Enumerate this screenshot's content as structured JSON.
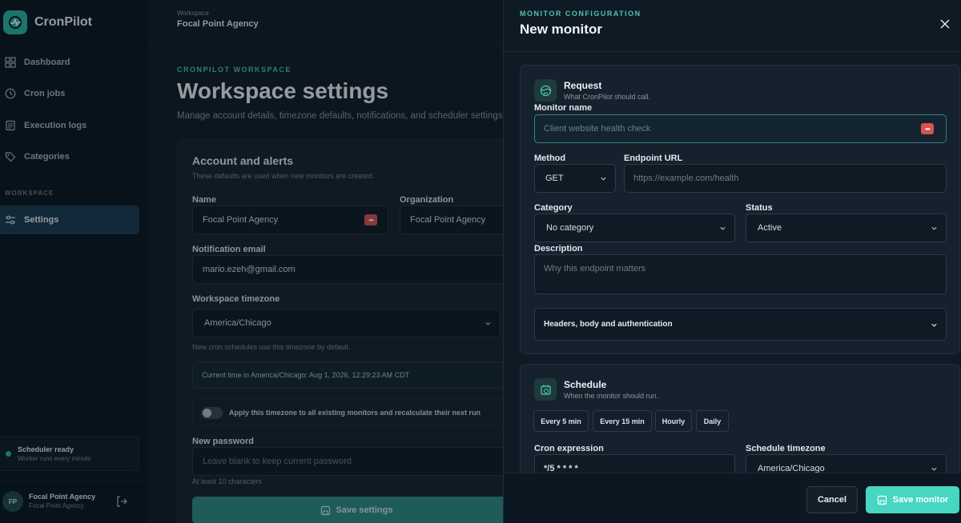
{
  "brand": {
    "name": "CronPilot"
  },
  "sidebar": {
    "items": [
      {
        "label": "Dashboard",
        "icon": "grid-icon"
      },
      {
        "label": "Cron jobs",
        "icon": "clock-icon"
      },
      {
        "label": "Execution logs",
        "icon": "log-icon"
      },
      {
        "label": "Categories",
        "icon": "tag-icon"
      }
    ],
    "section_label": "WORKSPACE",
    "settings_label": "Settings",
    "scheduler": {
      "title": "Scheduler ready",
      "subtitle": "Worker runs every minute"
    },
    "user": {
      "initials": "FP",
      "name": "Focal Point Agency",
      "org": "Focal Point Agency"
    }
  },
  "topbar": {
    "label": "Workspace",
    "title": "Focal Point Agency"
  },
  "page": {
    "eyebrow": "CRONPILOT WORKSPACE",
    "title": "Workspace settings",
    "description": "Manage account details, timezone defaults, notifications, and scheduler settings."
  },
  "account": {
    "title": "Account and alerts",
    "subtitle": "These defaults are used when new monitors are created.",
    "name_label": "Name",
    "name_value": "Focal Point Agency",
    "org_label": "Organization",
    "org_value": "Focal Point Agency",
    "email_label": "Notification email",
    "email_value": "mario.ezeh@gmail.com",
    "timezone_label": "Workspace timezone",
    "timezone_value": "America/Chicago",
    "timezone_hint": "New cron schedules use this timezone by default.",
    "current_time": "Current time in America/Chicago: Aug 1, 2026, 12:29:23 AM CDT",
    "apply_toggle_label": "Apply this timezone to all existing monitors and recalculate their next run",
    "password_label": "New password",
    "password_placeholder": "Leave blank to keep current password",
    "password_hint": "At least 10 characters",
    "save_label": "Save settings"
  },
  "drawer": {
    "eyebrow": "MONITOR CONFIGURATION",
    "title": "New monitor",
    "request": {
      "title": "Request",
      "subtitle": "What CronPilot should call.",
      "name_label": "Monitor name",
      "name_placeholder": "Client website health check",
      "method_label": "Method",
      "method_value": "GET",
      "url_label": "Endpoint URL",
      "url_placeholder": "https://example.com/health",
      "category_label": "Category",
      "category_value": "No category",
      "status_label": "Status",
      "status_value": "Active",
      "description_label": "Description",
      "description_placeholder": "Why this endpoint matters",
      "advanced_label": "Headers, body and authentication"
    },
    "schedule": {
      "title": "Schedule",
      "subtitle": "When the monitor should run.",
      "presets": [
        "Every 5 min",
        "Every 15 min",
        "Hourly",
        "Daily"
      ],
      "cron_label": "Cron expression",
      "cron_value": "*/5 * * * *",
      "tz_label": "Schedule timezone",
      "tz_value": "America/Chicago"
    },
    "cancel_label": "Cancel",
    "save_label": "Save monitor"
  },
  "colors": {
    "accent": "#47d6c2",
    "eyebrow": "#4fc3b0",
    "background": "#0f1b27"
  }
}
